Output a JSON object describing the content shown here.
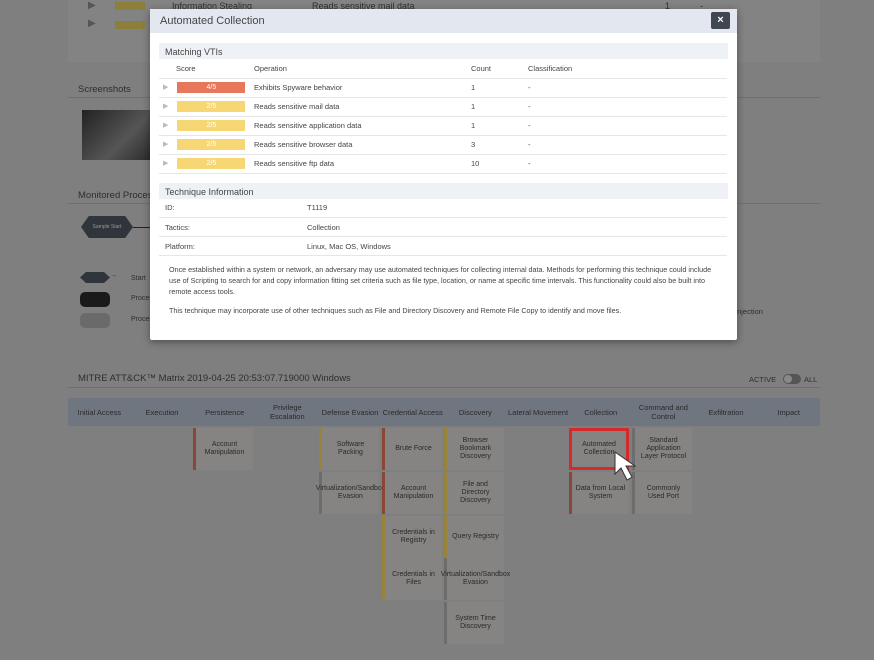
{
  "background": {
    "top_rows": [
      {
        "tactic": "Information Stealing",
        "operation": "Reads sensitive mail data",
        "count": "1",
        "classification": "-"
      }
    ],
    "screenshots_title": "Screenshots",
    "monitored_title": "Monitored Processes",
    "sample_start": "Sample Start",
    "legend": [
      "Start",
      "Process",
      "Process"
    ],
    "injection_label": "Injection",
    "matrix_title": "MITRE ATT&CK™ Matrix 2019-04-25 20:53:07.719000 Windows",
    "toggle": {
      "left": "ACTIVE",
      "right": "ALL"
    },
    "tactics": [
      "Initial Access",
      "Execution",
      "Persistence",
      "Privilege Escalation",
      "Defense Evasion",
      "Credential Access",
      "Discovery",
      "Lateral Movement",
      "Collection",
      "Command and Control",
      "Exfiltration",
      "Impact"
    ],
    "cells": {
      "persistence": [
        "Account Manipulation"
      ],
      "defense_evasion": [
        "Software Packing",
        "Virtualization/Sandbox Evasion"
      ],
      "credential_access": [
        "Brute Force",
        "Account Manipulation",
        "Credentials in Registry",
        "Credentials in Files"
      ],
      "discovery": [
        "Browser Bookmark Discovery",
        "File and Directory Discovery",
        "Query Registry",
        "Virtualization/Sandbox Evasion",
        "System Time Discovery"
      ],
      "collection": [
        "Automated Collection",
        "Data from Local System"
      ],
      "command_and_control": [
        "Standard Application Layer Protocol",
        "Commonly Used Port"
      ]
    }
  },
  "modal": {
    "title": "Automated Collection",
    "close": "×",
    "vti_title": "Matching VTIs",
    "columns": [
      "Score",
      "Operation",
      "Count",
      "Classification"
    ],
    "rows": [
      {
        "score": "4/5",
        "operation": "Exhibits Spyware behavior",
        "count": "1",
        "classification": "-",
        "color": "#e8765a"
      },
      {
        "score": "2/5",
        "operation": "Reads sensitive mail data",
        "count": "1",
        "classification": "-",
        "color": "#f7d774"
      },
      {
        "score": "2/5",
        "operation": "Reads sensitive application data",
        "count": "1",
        "classification": "-",
        "color": "#f7d774"
      },
      {
        "score": "2/5",
        "operation": "Reads sensitive browser data",
        "count": "3",
        "classification": "-",
        "color": "#f7d774"
      },
      {
        "score": "2/5",
        "operation": "Reads sensitive ftp data",
        "count": "10",
        "classification": "-",
        "color": "#f7d774"
      }
    ],
    "tech_title": "Technique Information",
    "info": [
      {
        "k": "ID:",
        "v": "T1119"
      },
      {
        "k": "Tactics:",
        "v": "Collection"
      },
      {
        "k": "Platform:",
        "v": "Linux, Mac OS, Windows"
      }
    ],
    "desc1": "Once established within a system or network, an adversary may use automated techniques for collecting internal data. Methods for performing this technique could include use of Scripting to search for and copy information fitting set criteria such as file type, location, or name at specific time intervals. This functionality could also be built into remote access tools.",
    "desc2": "This technique may incorporate use of other techniques such as File and Directory Discovery and Remote File Copy to identify and move files."
  }
}
